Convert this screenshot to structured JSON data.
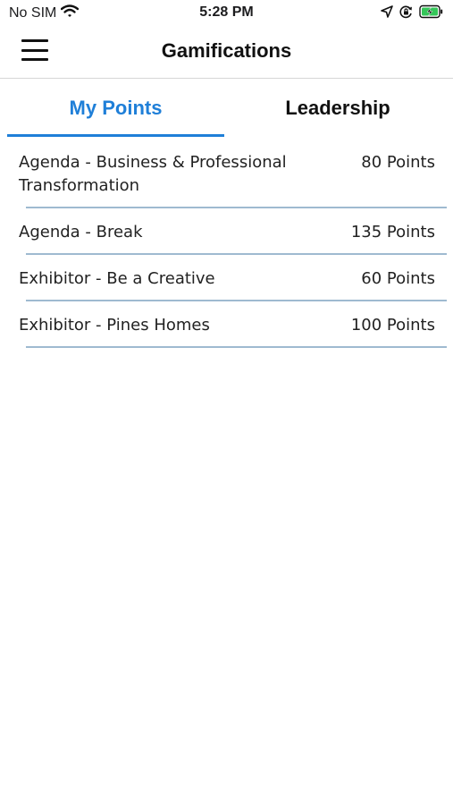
{
  "status_bar": {
    "carrier": "No SIM",
    "time": "5:28 PM",
    "icons": [
      "wifi-icon",
      "location-arrow-icon",
      "orientation-lock-icon",
      "battery-charging-icon"
    ]
  },
  "header": {
    "title": "Gamifications",
    "menu_icon": "hamburger-menu-icon"
  },
  "tabs": [
    {
      "label": "My Points",
      "active": true
    },
    {
      "label": "Leadership",
      "active": false
    }
  ],
  "points_list": [
    {
      "name": "Agenda - Business & Professional Transformation",
      "points": "80 Points"
    },
    {
      "name": "Agenda - Break",
      "points": "135 Points"
    },
    {
      "name": "Exhibitor - Be a Creative",
      "points": "60 Points"
    },
    {
      "name": "Exhibitor - Pines Homes",
      "points": "100 Points"
    }
  ],
  "colors": {
    "accent": "#1f7fd8",
    "divider": "#9fbad0",
    "battery": "#34c759"
  }
}
